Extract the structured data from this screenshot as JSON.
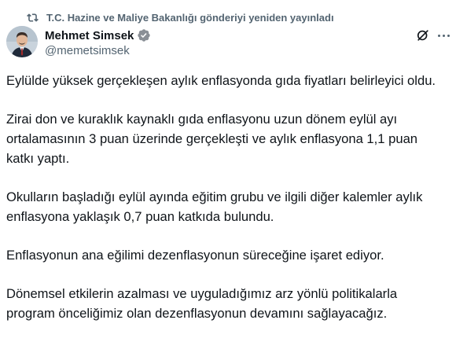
{
  "repost": {
    "icon": "repost-icon",
    "text": "T.C. Hazine ve Maliye Bakanlığı gönderiyi yeniden yayınladı"
  },
  "author": {
    "name": "Mehmet Simsek",
    "handle": "@memetsimsek",
    "verified_badge": "verified-badge-icon",
    "badge_color": "#8a8f96"
  },
  "actions": {
    "grok_icon": "grok-icon",
    "more_icon": "more-dots-icon"
  },
  "tweet": {
    "paragraphs": [
      "Eylülde yüksek gerçekleşen aylık enflasyonda gıda fiyatları belirleyici oldu.",
      "Zirai don ve kuraklık kaynaklı gıda enflasyonu uzun dönem eylül ayı ortalamasının 3 puan üzerinde gerçekleşti ve aylık enflasyona 1,1 puan katkı yaptı.",
      "Okulların başladığı eylül ayında eğitim grubu ve ilgili diğer kalemler aylık enflasyona yaklaşık 0,7 puan katkıda bulundu.",
      "Enflasyonun ana eğilimi dezenflasyonun süreceğine işaret ediyor.",
      "Dönemsel etkilerin azalması ve uyguladığımız arz yönlü politikalarla program önceliğimiz olan dezenflasyonun devamını sağlayacağız."
    ]
  },
  "colors": {
    "text_primary": "#0f1419",
    "text_secondary": "#536471",
    "background": "#ffffff"
  }
}
